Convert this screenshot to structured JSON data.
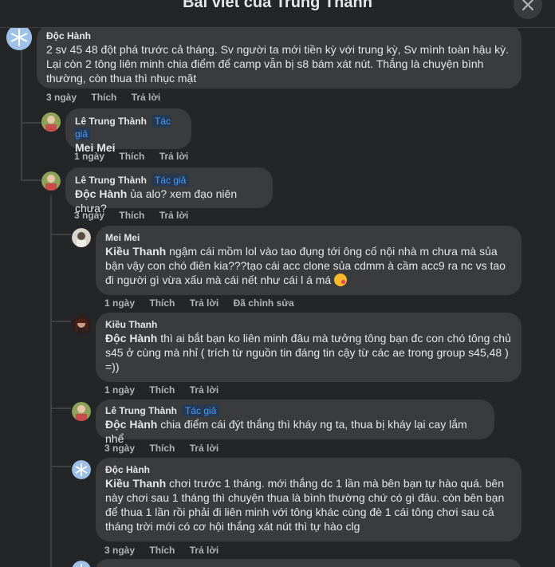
{
  "header": {
    "title": "Bài viết của Trung Thành"
  },
  "comments": [
    {
      "author": "Độc Hành",
      "text": "2 sv 45 48 đột phá trước cả tháng. Sv người ta mới tiền kỳ với trung kỳ, Sv mình toàn hậu kỳ. Lại còn 2 tông liên minh chia điểm để camp vẫn bị s8 bám xát nút. Thắng là chuyện bình thường, còn thua thì nhục mặt",
      "time": "3 ngày",
      "like": "Thích",
      "reply": "Trả lời"
    },
    {
      "author": "Lê Trung Thành",
      "badge": "Tác giả",
      "text": "Mei Mei",
      "time": "1 ngày",
      "like": "Thích",
      "reply": "Trả lời"
    },
    {
      "author": "Lê Trung Thành",
      "badge": "Tác giả",
      "mention": "Độc Hành",
      "text": " ủa alo? xem đạo niên chưa?",
      "time": "3 ngày",
      "like": "Thích",
      "reply": "Trả lời"
    },
    {
      "author": "Mei Mei",
      "mention": "Kiều Thanh",
      "text": " ngậm cái mồm lol vào tao đụng tới ông cố nội nhà m chưa mà sủa bận vậy con chó điên kia???tạo cái acc clone sủa cdmm à cầm acc9 ra nc vs tao đi người gì vừa xấu mà cái nết như cái l á má ",
      "time": "1 ngày",
      "like": "Thích",
      "reply": "Trả lời",
      "edited": "Đã chỉnh sửa"
    },
    {
      "author": "Kiều Thanh",
      "mention": "Độc Hành",
      "text": " thì ai bắt bạn ko liên minh đâu mà tưởng tông bạn đc con chó tông chủ s45 ở cùng mà nhỉ ( trích từ nguồn tin đáng tin cậy từ các ae trong group s45,48 ) =))",
      "time": "1 ngày",
      "like": "Thích",
      "reply": "Trả lời"
    },
    {
      "author": "Lê Trung Thành",
      "badge": "Tác giả",
      "mention": "Độc Hành",
      "text": " chia điểm cái đýt thắng thì kháy ng ta, thua bị kháy lại cay lắm nhể",
      "time": "3 ngày",
      "like": "Thích",
      "reply": "Trả lời"
    },
    {
      "author": "Độc Hành",
      "mention": "Kiều Thanh",
      "text": " chơi trước 1 tháng. mới thắng dc 1 lần mà bên bạn tự hào quá. bên này chơi sau 1 tháng thì chuyện thua là bình thường chứ có gì đâu. còn bên bạn để thua 1 lần rồi phải đi liên minh với tông khác cùng đè 1 cái tông chơi sau cả tháng trời mới có cơ hội thắng xát nút thì tự hào clg",
      "time": "3 ngày",
      "like": "Thích",
      "reply": "Trả lời"
    }
  ]
}
